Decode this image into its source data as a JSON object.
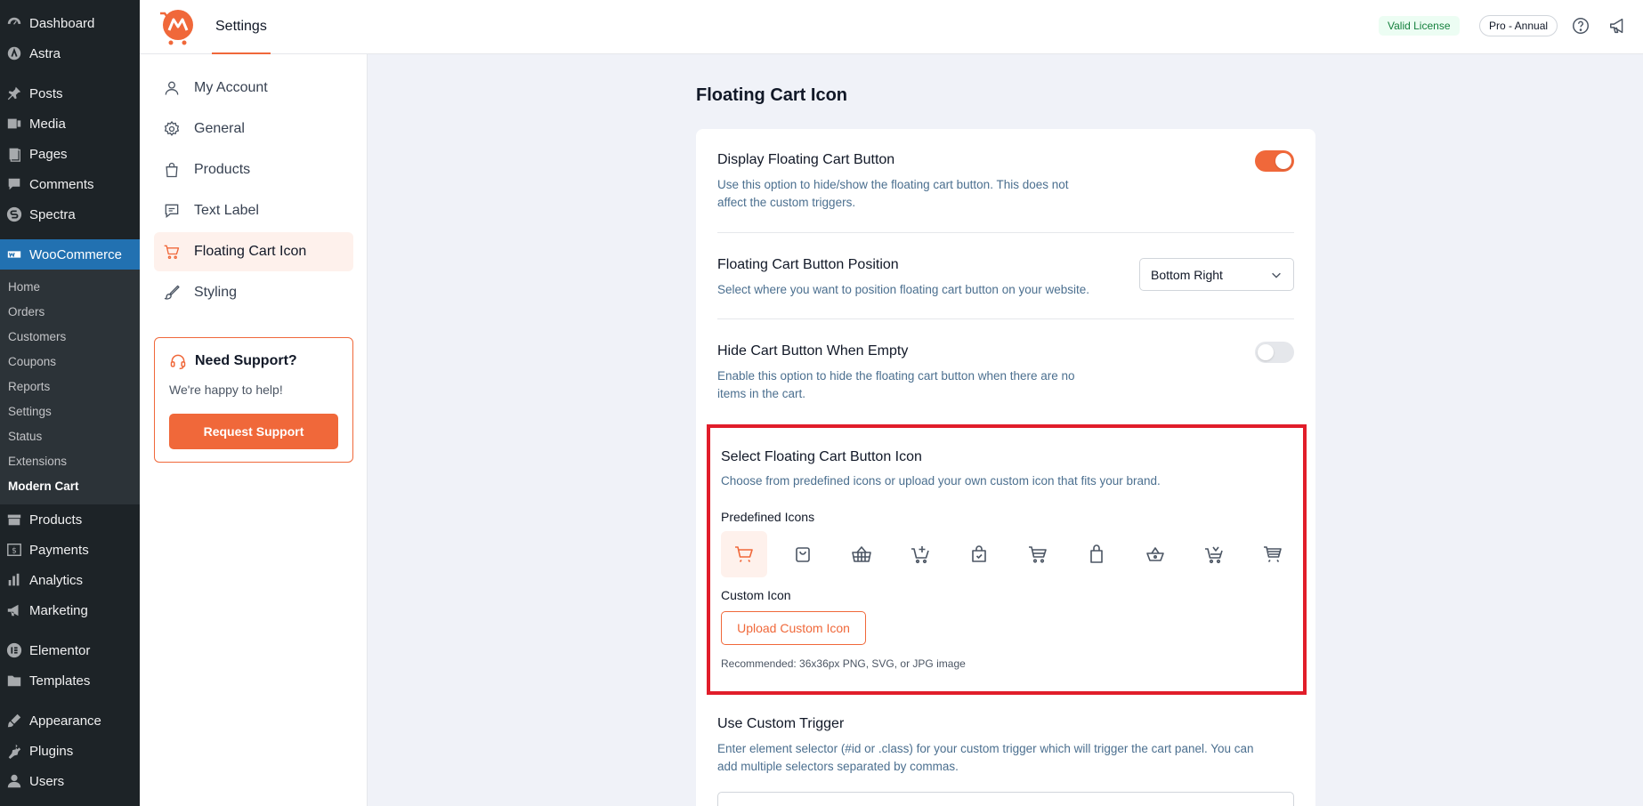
{
  "wp_menu": {
    "items": [
      {
        "label": "Dashboard",
        "icon": "dashboard-icon"
      },
      {
        "label": "Astra",
        "icon": "astra-icon"
      },
      {
        "label": "Posts",
        "icon": "pin-icon"
      },
      {
        "label": "Media",
        "icon": "media-icon"
      },
      {
        "label": "Pages",
        "icon": "pages-icon"
      },
      {
        "label": "Comments",
        "icon": "comment-icon"
      },
      {
        "label": "Spectra",
        "icon": "spectra-icon"
      },
      {
        "label": "WooCommerce",
        "icon": "woo-icon"
      }
    ],
    "woo_sub": [
      "Home",
      "Orders",
      "Customers",
      "Coupons",
      "Reports",
      "Settings",
      "Status",
      "Extensions",
      "Modern Cart"
    ],
    "items_after": [
      {
        "label": "Products",
        "icon": "archive-icon"
      },
      {
        "label": "Payments",
        "icon": "payments-icon"
      },
      {
        "label": "Analytics",
        "icon": "bar-chart-icon"
      },
      {
        "label": "Marketing",
        "icon": "megaphone-icon"
      },
      {
        "label": "Elementor",
        "icon": "elementor-icon"
      },
      {
        "label": "Templates",
        "icon": "folder-icon"
      },
      {
        "label": "Appearance",
        "icon": "brush-icon"
      },
      {
        "label": "Plugins",
        "icon": "plug-icon"
      },
      {
        "label": "Users",
        "icon": "user-icon"
      }
    ]
  },
  "topbar": {
    "tab": "Settings",
    "license": "Valid License",
    "plan": "Pro - Annual"
  },
  "settings_nav": {
    "items": [
      "My Account",
      "General",
      "Products",
      "Text Label",
      "Floating Cart Icon",
      "Styling"
    ],
    "active": "Floating Cart Icon"
  },
  "support": {
    "title": "Need Support?",
    "text": "We're happy to help!",
    "button": "Request Support"
  },
  "main": {
    "title": "Floating Cart Icon",
    "display": {
      "title": "Display Floating Cart Button",
      "desc1": "Use this option to hide/show the floating cart button. This does not",
      "desc2": "affect the custom triggers.",
      "enabled": true
    },
    "position": {
      "title": "Floating Cart Button Position",
      "desc": "Select where you want to position floating cart button on your website.",
      "value": "Bottom Right"
    },
    "hide_empty": {
      "title": "Hide Cart Button When Empty",
      "desc1": "Enable this option to hide the floating cart button when there are no",
      "desc2": "items in the cart.",
      "enabled": false
    },
    "icon_select": {
      "title": "Select Floating Cart Button Icon",
      "desc": "Choose from predefined icons or upload your own custom icon that fits your brand.",
      "predefined_label": "Predefined Icons",
      "icons": [
        "cart-icon",
        "bag-icon",
        "basket-icon",
        "cart-plus-icon",
        "shopping-bag-icon",
        "cart-outline-icon",
        "bag-simple-icon",
        "basket-round-icon",
        "cart-add-icon",
        "cart-lines-icon"
      ],
      "selected_index": 0,
      "custom_label": "Custom Icon",
      "upload_button": "Upload Custom Icon",
      "recommendation": "Recommended: 36x36px PNG, SVG, or JPG image"
    },
    "trigger": {
      "title": "Use Custom Trigger",
      "desc1": "Enter element selector (#id or .class) for your custom trigger which will trigger the cart panel. You can",
      "desc2": "add multiple selectors separated by commas."
    }
  },
  "colors": {
    "accent": "#f0683a",
    "wp_blue": "#2271b1",
    "highlight_red": "#e11d2a"
  }
}
